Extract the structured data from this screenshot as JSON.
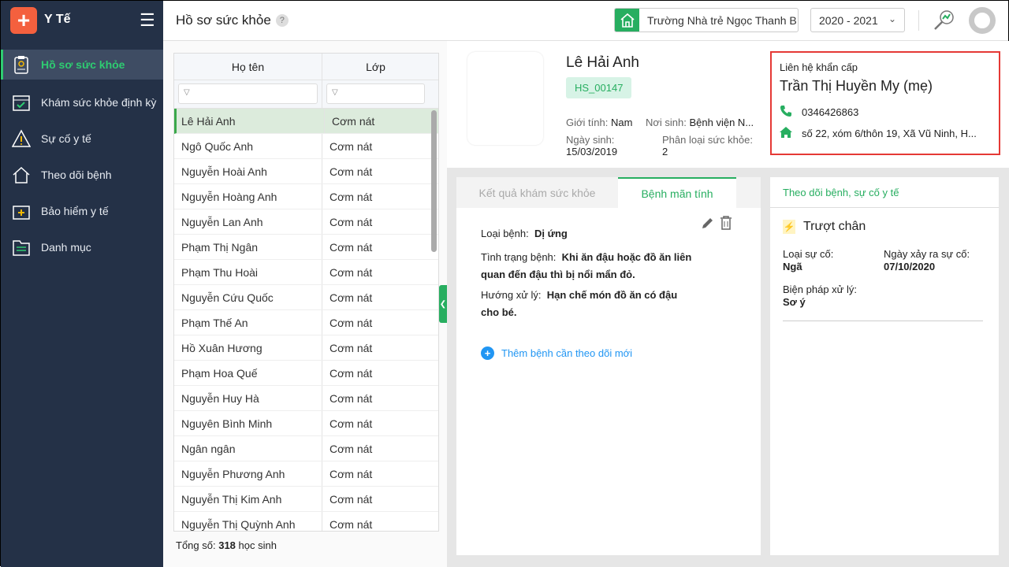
{
  "app": {
    "name": "Y Tế",
    "logo_glyph": "+"
  },
  "sidebar": {
    "items": [
      {
        "label": "Hồ sơ sức khỏe",
        "icon": "clipboard-icon",
        "active": true
      },
      {
        "label": "Khám sức khỏe định kỳ",
        "icon": "calendar-check-icon"
      },
      {
        "label": "Sự cố y tế",
        "icon": "warning-icon"
      },
      {
        "label": "Theo dõi bệnh",
        "icon": "house-icon"
      },
      {
        "label": "Bảo hiểm y tế",
        "icon": "medkit-icon"
      },
      {
        "label": "Danh mục",
        "icon": "folder-icon"
      }
    ]
  },
  "header": {
    "title": "Hồ sơ sức khỏe",
    "help": "?",
    "school": "Trường Nhà trẻ Ngọc Thanh B",
    "year": "2020 - 2021"
  },
  "table": {
    "headers": [
      "Họ tên",
      "Lớp"
    ],
    "filter_icon": "▽",
    "rows": [
      [
        "Lê Hải Anh",
        "Cơm nát"
      ],
      [
        "Ngô Quốc Anh",
        "Cơm nát"
      ],
      [
        "Nguyễn Hoài Anh",
        "Cơm nát"
      ],
      [
        "Nguyễn Hoàng Anh",
        "Cơm nát"
      ],
      [
        "Nguyễn Lan Anh",
        "Cơm nát"
      ],
      [
        "Phạm Thị Ngân",
        "Cơm nát"
      ],
      [
        "Phạm Thu Hoài",
        "Cơm nát"
      ],
      [
        "Nguyễn Cứu Quốc",
        "Cơm nát"
      ],
      [
        "Phạm Thế An",
        "Cơm nát"
      ],
      [
        "Hồ Xuân Hương",
        "Cơm nát"
      ],
      [
        "Phạm Hoa Quế",
        "Cơm nát"
      ],
      [
        "Nguyễn Huy Hà",
        "Cơm nát"
      ],
      [
        "Nguyên Bình Minh",
        "Cơm nát"
      ],
      [
        "Ngân ngân",
        "Cơm nát"
      ],
      [
        "Nguyễn Phương Anh",
        "Cơm nát"
      ],
      [
        "Nguyễn Thị Kim Anh",
        "Cơm nát"
      ],
      [
        "Nguyễn Thị Quỳnh Anh",
        "Cơm nát"
      ]
    ],
    "total_label": "Tổng số:",
    "total_value": "318",
    "total_unit": "học sinh"
  },
  "profile": {
    "name": "Lê Hải Anh",
    "code": "HS_00147",
    "gender_label": "Giới tính:",
    "gender": "Nam",
    "birthplace_label": "Nơi sinh:",
    "birthplace": "Bệnh viện N...",
    "dob_label": "Ngày sinh:",
    "dob": "15/03/2019",
    "health_label": "Phân loại sức khỏe:",
    "health": "2"
  },
  "emergency": {
    "label": "Liên hệ khẩn cấp",
    "name": "Trần Thị Huyền My (mẹ)",
    "phone": "0346426863",
    "address": "số 22, xóm 6/thôn 19, Xã Vũ Ninh, H..."
  },
  "disease_card": {
    "tabs": [
      "Kết quả khám sức khỏe",
      "Bệnh mãn tính"
    ],
    "type_label": "Loại bệnh:",
    "type": "Dị ứng",
    "status_label": "Tình trạng bệnh:",
    "status": "Khi ăn đậu hoặc đồ ăn liên quan đến đậu thì bị nổi mẩn đỏ.",
    "treat_label": "Hướng xử lý:",
    "treat": "Hạn chế món đồ ăn có đậu cho bé.",
    "add_label": "Thêm bệnh cần theo dõi mới"
  },
  "incident_card": {
    "title": "Theo dõi bệnh, sự cố y tế",
    "incident": "Trượt chân",
    "type_label": "Loại sự cố:",
    "type": "Ngã",
    "date_label": "Ngày xảy ra sự cố:",
    "date": "07/10/2020",
    "measure_label": "Biện pháp xử lý:",
    "measure": "Sơ ý"
  },
  "colors": {
    "sidebar": "#243147",
    "accent": "#27ae60",
    "highlight": "#e53935"
  }
}
